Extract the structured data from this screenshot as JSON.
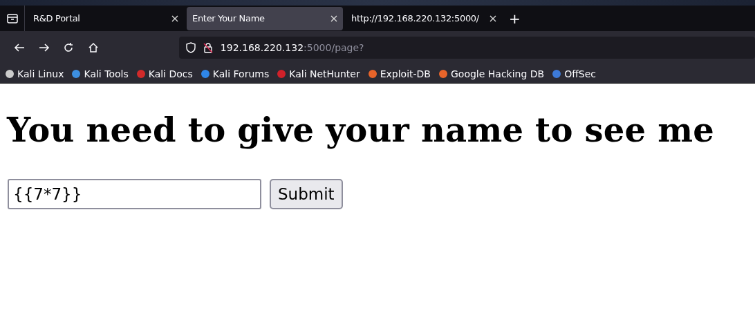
{
  "tabs": [
    {
      "title": "R&D Portal",
      "selected": false
    },
    {
      "title": "Enter Your Name",
      "selected": true
    },
    {
      "title": "http://192.168.220.132:5000/",
      "selected": false
    }
  ],
  "new_tab": "+",
  "address": {
    "host": "192.168.220.132",
    "rest": ":5000/page?"
  },
  "bookmarks": [
    {
      "label": "Kali Linux",
      "color": "#cccccc"
    },
    {
      "label": "Kali Tools",
      "color": "#3d8fe0"
    },
    {
      "label": "Kali Docs",
      "color": "#d22a2a"
    },
    {
      "label": "Kali Forums",
      "color": "#2f86e8"
    },
    {
      "label": "Kali NetHunter",
      "color": "#d0212a"
    },
    {
      "label": "Exploit-DB",
      "color": "#e8642a"
    },
    {
      "label": "Google Hacking DB",
      "color": "#e8642a"
    },
    {
      "label": "OffSec",
      "color": "#3d7ad8"
    }
  ],
  "page": {
    "heading": "You need to give your name to see me",
    "name_field": {
      "value": "{{7*7}}"
    },
    "submit": "Submit"
  }
}
